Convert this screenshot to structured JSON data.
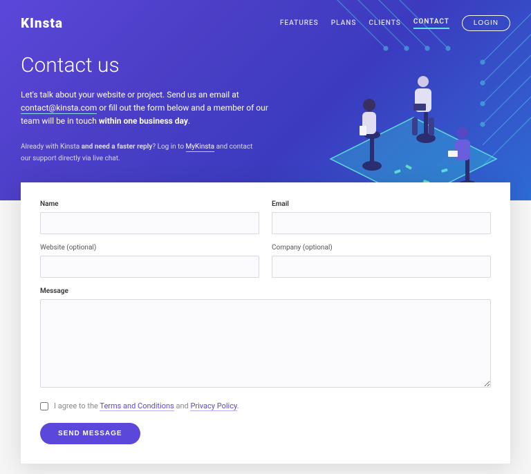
{
  "brand": "KInsta",
  "nav": {
    "features": "FEATURES",
    "plans": "PLANS",
    "clients": "CLIENTS",
    "contact": "CONTACT",
    "login": "LOGIN"
  },
  "hero": {
    "title": "Contact us",
    "intro_pre": "Let's talk about your website or project. Send us an email at ",
    "intro_email": "contact@kinsta.com",
    "intro_mid": " or fill out the form below and a member of our team will be in touch ",
    "intro_bold": "within one business day",
    "intro_end": ".",
    "already_pre": "Already with Kinsta ",
    "already_bold": "and need a faster reply",
    "already_q": "? Log in to ",
    "already_link": "MyKinsta",
    "already_end": " and contact our support directly via live chat."
  },
  "form": {
    "name_label": "Name",
    "email_label": "Email",
    "website_label": "Website (optional)",
    "company_label": "Company (optional)",
    "message_label": "Message",
    "consent_pre": "I agree to the ",
    "consent_terms": "Terms and Conditions",
    "consent_and": " and ",
    "consent_privacy": "Privacy Policy",
    "consent_end": ".",
    "submit": "SEND MESSAGE"
  },
  "colors": {
    "accent": "#5b47d9",
    "teal": "#5de3e0"
  }
}
